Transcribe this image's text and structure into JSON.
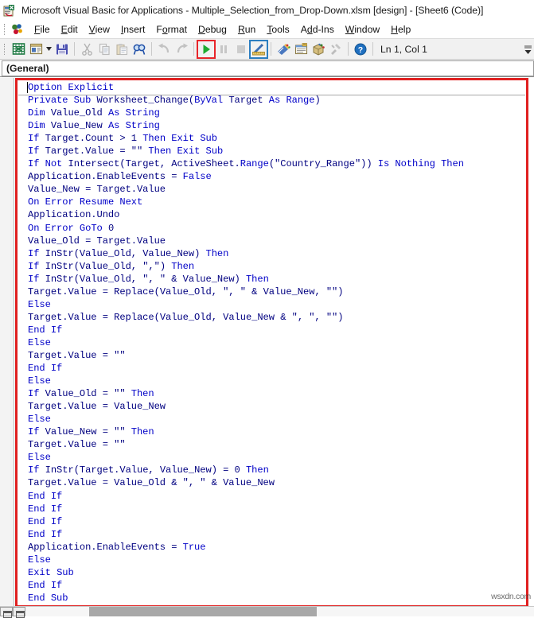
{
  "window": {
    "title": "Microsoft Visual Basic for Applications - Multiple_Selection_from_Drop-Down.xlsm [design] - [Sheet6 (Code)]",
    "app_icon": "vba-excel-icon"
  },
  "menubar": {
    "logo_icon": "vba-logo-icon",
    "items": [
      {
        "label": "File",
        "icon": "menu-file"
      },
      {
        "label": "Edit",
        "icon": "menu-edit"
      },
      {
        "label": "View",
        "icon": "menu-view"
      },
      {
        "label": "Insert",
        "icon": "menu-insert"
      },
      {
        "label": "Format",
        "icon": "menu-format"
      },
      {
        "label": "Debug",
        "icon": "menu-debug"
      },
      {
        "label": "Run",
        "icon": "menu-run"
      },
      {
        "label": "Tools",
        "icon": "menu-tools"
      },
      {
        "label": "Add-Ins",
        "icon": "menu-addins"
      },
      {
        "label": "Window",
        "icon": "menu-window"
      },
      {
        "label": "Help",
        "icon": "menu-help"
      }
    ]
  },
  "toolbar": {
    "buttons": [
      {
        "name": "view-excel-icon",
        "enabled": true
      },
      {
        "name": "insert-userform-icon",
        "enabled": true,
        "has_dropdown": true
      },
      {
        "name": "save-icon",
        "enabled": true
      },
      {
        "name": "cut-icon",
        "enabled": false
      },
      {
        "name": "copy-icon",
        "enabled": false
      },
      {
        "name": "paste-icon",
        "enabled": false
      },
      {
        "name": "find-icon",
        "enabled": true
      },
      {
        "name": "undo-icon",
        "enabled": false
      },
      {
        "name": "redo-icon",
        "enabled": false
      },
      {
        "name": "run-icon",
        "enabled": true,
        "highlight": "red"
      },
      {
        "name": "pause-icon",
        "enabled": false
      },
      {
        "name": "stop-icon",
        "enabled": false
      },
      {
        "name": "design-mode-icon",
        "enabled": true,
        "highlight": "blue"
      },
      {
        "name": "project-explorer-icon",
        "enabled": true
      },
      {
        "name": "properties-window-icon",
        "enabled": true
      },
      {
        "name": "object-browser-icon",
        "enabled": true
      },
      {
        "name": "toolbox-icon",
        "enabled": false
      },
      {
        "name": "help-icon",
        "enabled": true
      }
    ],
    "position_label": "Ln 1, Col 1",
    "overflow_icon": "toolbar-overflow-chevron",
    "highlight_colors": {
      "run": "#e8252a",
      "design_mode": "#2b7ec1"
    }
  },
  "code_window": {
    "object_combo_value": "(General)",
    "procedure_combo_value": "",
    "annotation_box_color": "#e02020",
    "code_color": "#000080",
    "keyword_color": "#0000c8",
    "lines": [
      "Option Explicit",
      "Private Sub Worksheet_Change(ByVal Target As Range)",
      "Dim Value_Old As String",
      "Dim Value_New As String",
      "If Target.Count > 1 Then Exit Sub",
      "If Target.Value = \"\" Then Exit Sub",
      "If Not Intersect(Target, ActiveSheet.Range(\"Country_Range\")) Is Nothing Then",
      "Application.EnableEvents = False",
      "Value_New = Target.Value",
      "On Error Resume Next",
      "Application.Undo",
      "On Error GoTo 0",
      "Value_Old = Target.Value",
      "If InStr(Value_Old, Value_New) Then",
      "If InStr(Value_Old, \",\") Then",
      "If InStr(Value_Old, \", \" & Value_New) Then",
      "Target.Value = Replace(Value_Old, \", \" & Value_New, \"\")",
      "Else",
      "Target.Value = Replace(Value_Old, Value_New & \", \", \"\")",
      "End If",
      "Else",
      "Target.Value = \"\"",
      "End If",
      "Else",
      "If Value_Old = \"\" Then",
      "Target.Value = Value_New",
      "Else",
      "If Value_New = \"\" Then",
      "Target.Value = \"\"",
      "Else",
      "If InStr(Target.Value, Value_New) = 0 Then",
      "Target.Value = Value_Old & \", \" & Value_New",
      "End If",
      "End If",
      "End If",
      "End If",
      "Application.EnableEvents = True",
      "Else",
      "Exit Sub",
      "End If",
      "End Sub"
    ]
  },
  "watermark": {
    "text": "wsxdn.com"
  },
  "scrollbar": {
    "full_view_icon": "full-module-view-icon",
    "procedure_view_icon": "procedure-view-icon"
  }
}
